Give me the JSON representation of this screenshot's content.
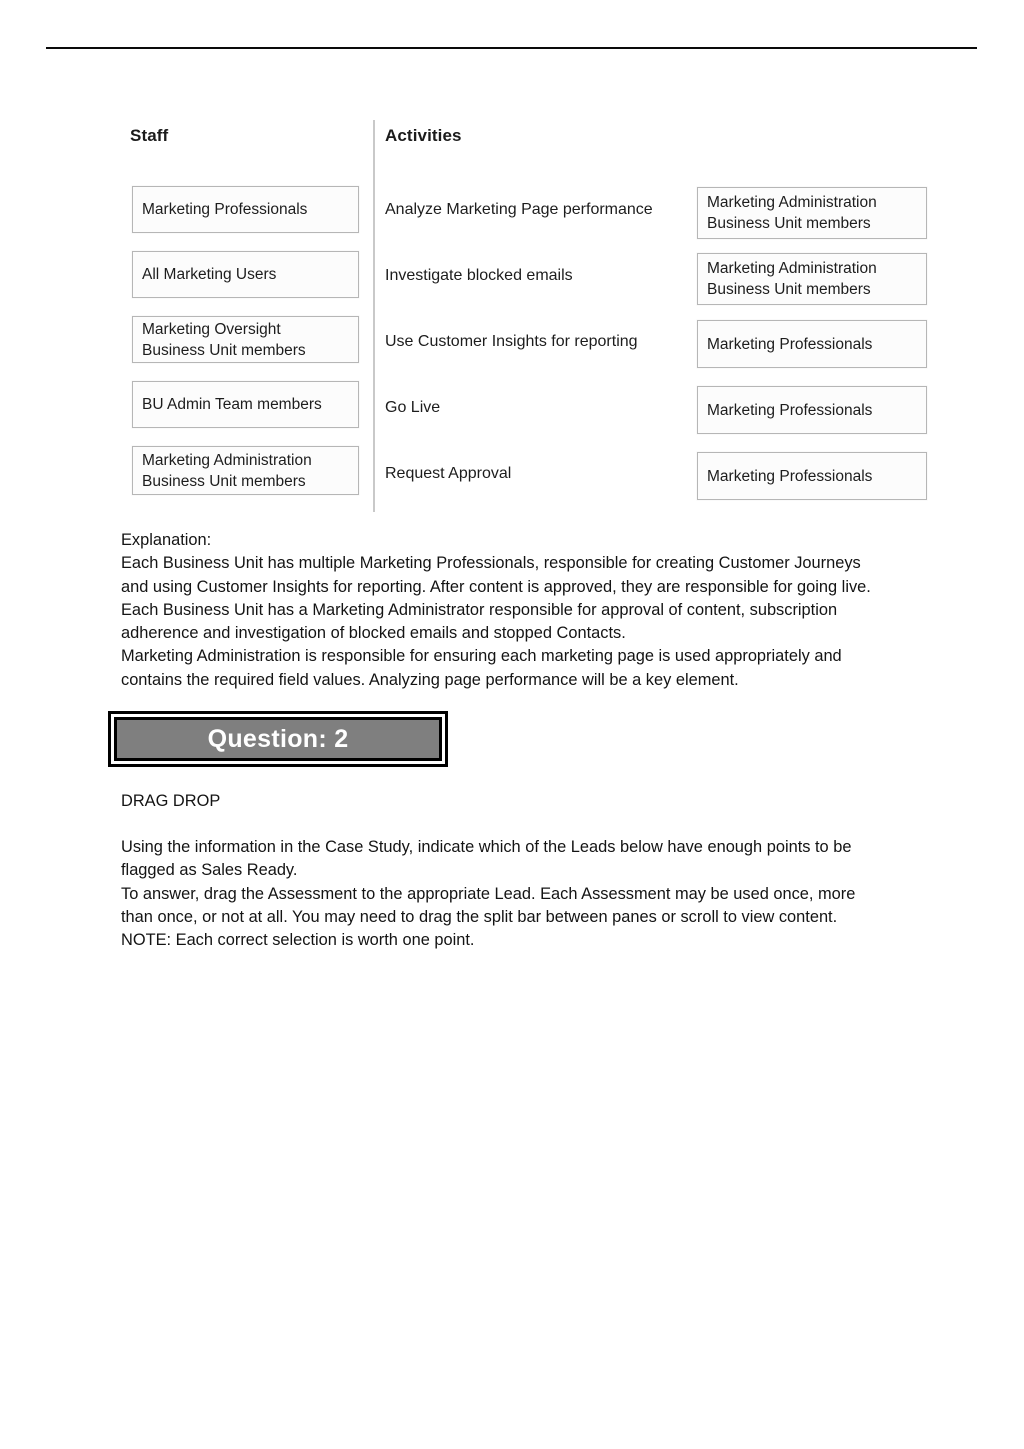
{
  "page": {
    "background": "#ffffff",
    "rule_color": "#0a0a0a"
  },
  "exhibit": {
    "columns": {
      "staff_header": "Staff",
      "activities_header": "Activities"
    },
    "staff_options": [
      {
        "line1": "Marketing Professionals",
        "line2": ""
      },
      {
        "line1": "All Marketing Users",
        "line2": ""
      },
      {
        "line1": "Marketing Oversight",
        "line2": "Business Unit members"
      },
      {
        "line1": "BU Admin Team members",
        "line2": ""
      },
      {
        "line1": "Marketing Administration",
        "line2": "Business Unit members"
      }
    ],
    "activities": [
      {
        "label": "Analyze Marketing Page performance",
        "answer_line1": "Marketing Administration",
        "answer_line2": "Business Unit members"
      },
      {
        "label": "Investigate blocked emails",
        "answer_line1": "Marketing Administration",
        "answer_line2": "Business Unit members"
      },
      {
        "label": "Use Customer Insights for reporting",
        "answer_line1": "Marketing Professionals",
        "answer_line2": ""
      },
      {
        "label": "Go Live",
        "answer_line1": "Marketing Professionals",
        "answer_line2": ""
      },
      {
        "label": "Request Approval",
        "answer_line1": "Marketing Professionals",
        "answer_line2": ""
      }
    ]
  },
  "explanation": {
    "heading": "Explanation:",
    "line1": "Each Business Unit has multiple Marketing Professionals, responsible for creating Customer Journeys",
    "line2": "and using Customer Insights for reporting. After content is approved, they are responsible for going live.",
    "line3": "Each Business Unit has a Marketing Administrator responsible for approval of content, subscription",
    "line4": "adherence and investigation of blocked emails and stopped Contacts.",
    "line5": "Marketing Administration is responsible for ensuring each marketing page is used appropriately and",
    "line6": "contains the required field values. Analyzing page performance will be a key element."
  },
  "question_banner": {
    "title": "Question: 2",
    "fill_color": "#7f7f7f",
    "text_color": "#ffffff",
    "border_color": "#000000"
  },
  "question": {
    "type_label": "DRAG DROP",
    "line1": "Using the information in the Case Study, indicate which of the Leads below have enough points to be",
    "line2": "flagged as Sales Ready.",
    "line3": "To answer, drag the Assessment to the appropriate Lead. Each Assessment may be used once, more",
    "line4": "than once, or not at all. You may need to drag the split bar between panes or scroll to view content.",
    "line5": "NOTE: Each correct selection is worth one point."
  }
}
